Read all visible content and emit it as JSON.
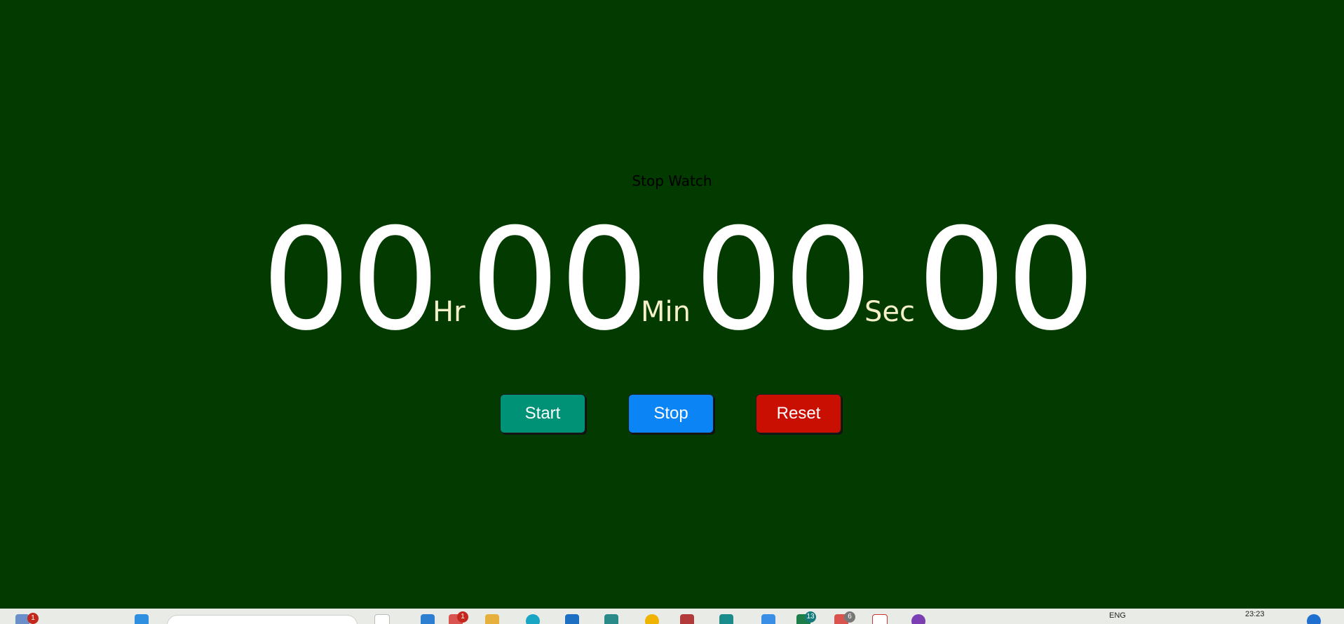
{
  "app": {
    "title": "Stop Watch"
  },
  "clock": {
    "hours": "00",
    "hours_unit": "Hr",
    "minutes": "00",
    "minutes_unit": "Min",
    "seconds": "00",
    "seconds_unit": "Sec",
    "centiseconds": "00"
  },
  "controls": {
    "start_label": "Start",
    "stop_label": "Stop",
    "reset_label": "Reset"
  },
  "colors": {
    "background": "#023a00",
    "digits": "#ffffff",
    "units": "#f5f0c9",
    "start": "#009276",
    "stop": "#0b84f5",
    "reset": "#c90e02"
  },
  "taskbar": {
    "widgets_badge": "1",
    "app_badge_1": "1",
    "app_badge_2": "13",
    "app_badge_3": "6",
    "language": "ENG",
    "time": "23:23"
  }
}
